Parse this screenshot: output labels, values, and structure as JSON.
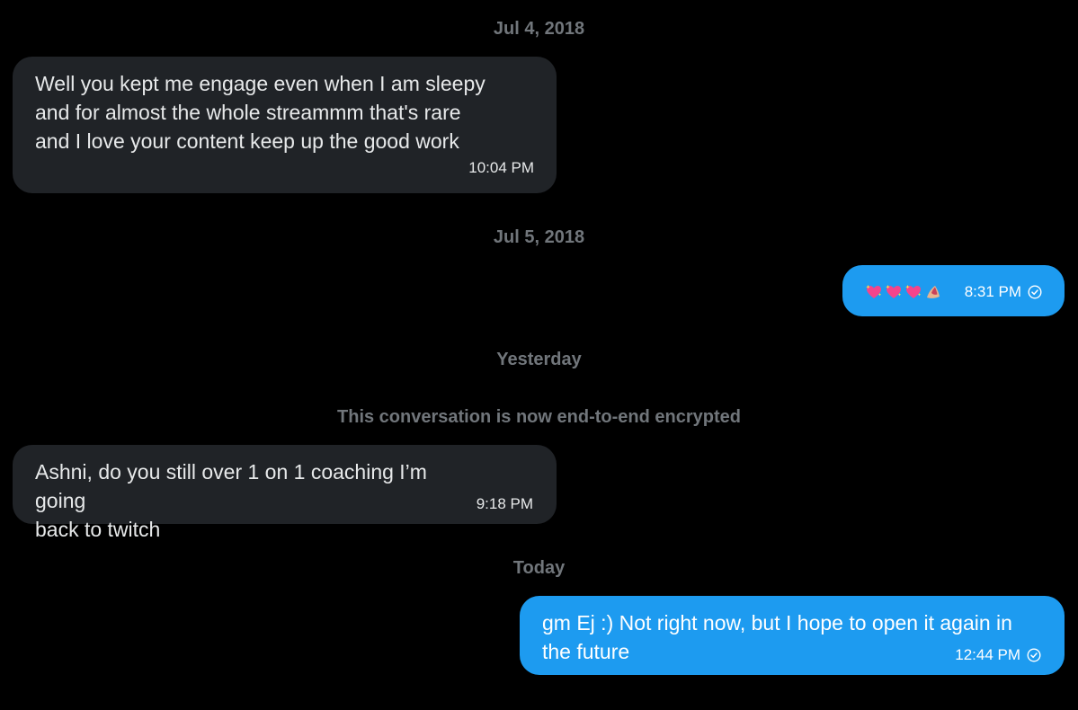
{
  "conversation": {
    "separators": {
      "jul4": "Jul 4, 2018",
      "jul5": "Jul 5, 2018",
      "yesterday": "Yesterday",
      "encrypted_notice": "This conversation is now end-to-end encrypted",
      "today": "Today"
    },
    "messages": [
      {
        "direction": "received",
        "text": "Well you kept me engage even when I am sleepy\nand for almost the whole streammm that's rare\nand I love your content keep up the good work",
        "time": "10:04 PM"
      },
      {
        "direction": "sent",
        "emoji": [
          "sparkling-heart",
          "sparkling-heart",
          "sparkling-heart",
          "nail-polish"
        ],
        "time": "8:31 PM",
        "status_icon": "check-circle-icon"
      },
      {
        "direction": "received",
        "text": "Ashni, do you still over 1 on 1 coaching I’m going\nback to twitch",
        "time": "9:18 PM"
      },
      {
        "direction": "sent",
        "text": "gm Ej :) Not right now, but I hope to open it again in\nthe future",
        "time": "12:44 PM",
        "status_icon": "check-circle-icon"
      }
    ]
  },
  "colors": {
    "background": "#000000",
    "received_bubble": "#202327",
    "sent_bubble": "#1d9bf0",
    "muted_text": "#71767b"
  }
}
